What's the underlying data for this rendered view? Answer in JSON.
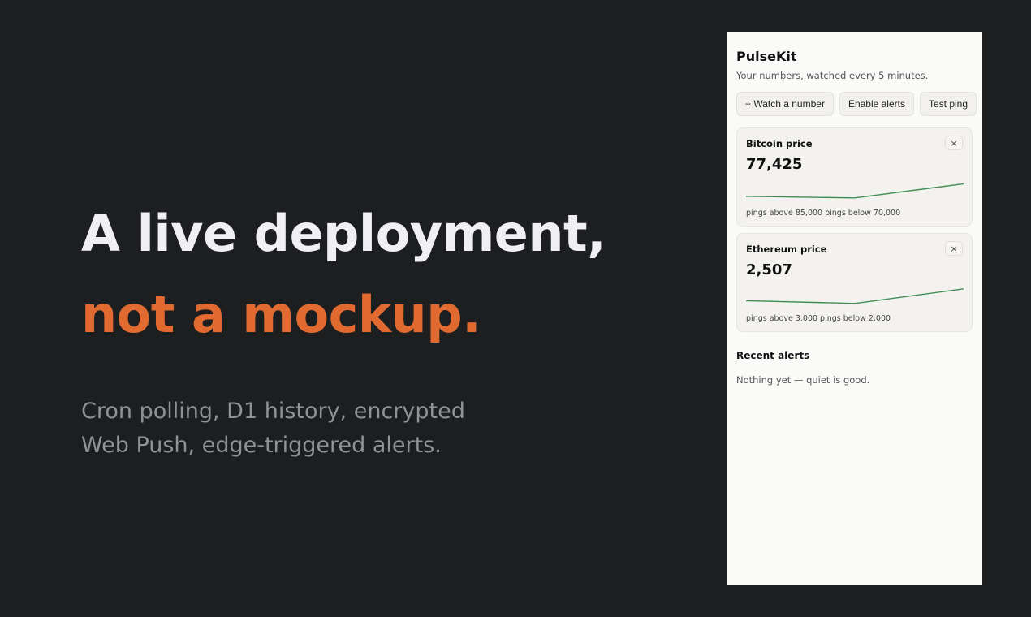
{
  "hero": {
    "headline_line1": "A live deployment,",
    "headline_line2": "not a mockup.",
    "subline": "Cron polling, D1 history, encrypted Web Push, edge-triggered alerts."
  },
  "app": {
    "title": "PulseKit",
    "subtitle": "Your numbers, watched every 5 minutes.",
    "buttons": {
      "watch": "+ Watch a number",
      "enable_alerts": "Enable alerts",
      "test_ping": "Test ping"
    },
    "cards": [
      {
        "title": "Bitcoin price",
        "value": "77,425",
        "close_icon": "×",
        "thresholds": "pings above 85,000 pings below 70,000",
        "sparkline": [
          0.15,
          0.08,
          0.7
        ]
      },
      {
        "title": "Ethereum price",
        "value": "2,507",
        "close_icon": "×",
        "thresholds": "pings above 3,000 pings below 2,000",
        "sparkline": [
          0.2,
          0.08,
          0.72
        ]
      }
    ],
    "recent_alerts_title": "Recent alerts",
    "recent_alerts_empty": "Nothing yet — quiet is good."
  },
  "colors": {
    "background": "#1d1e20",
    "accent": "#e06a30",
    "sparkline": "#3f8f55"
  }
}
